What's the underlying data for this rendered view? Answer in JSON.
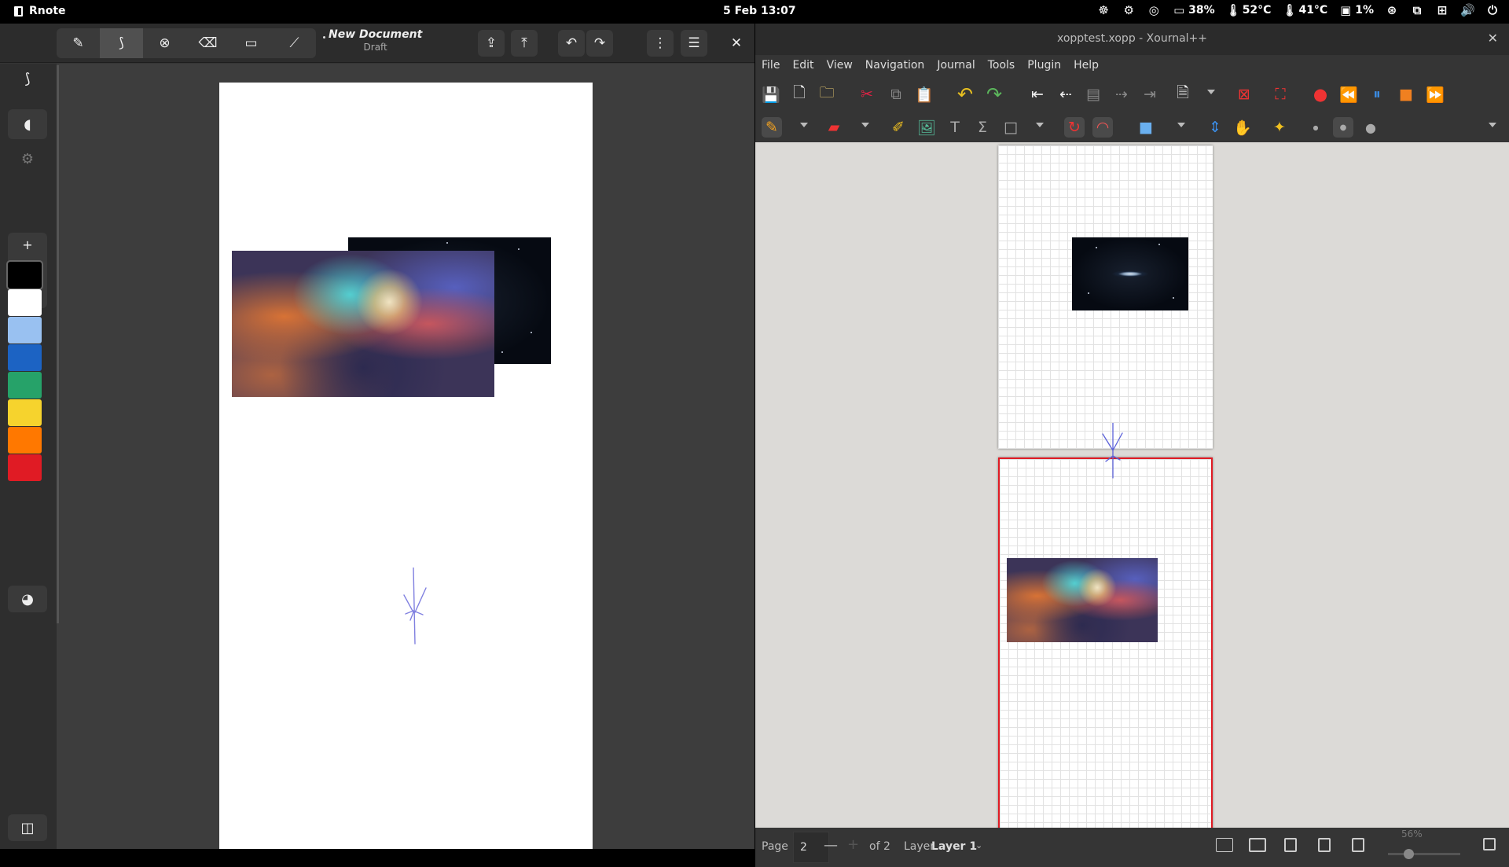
{
  "topbar": {
    "app_name": "Rnote",
    "clock": "5 Feb  13:07",
    "battery": "38%",
    "cpu_temp": "52°C",
    "gpu_temp": "41°C",
    "disk": "1%"
  },
  "rnote": {
    "tools": [
      "pen",
      "shaper",
      "selector",
      "eraser",
      "typewriter",
      "tools"
    ],
    "active_tool_index": 1,
    "doc_title": "New Document",
    "doc_status": "Draft",
    "pen_size": "3.8",
    "colors": [
      "#000000",
      "#ffffff",
      "#99c1f1",
      "#1c63c3",
      "#26a269",
      "#f6d32d",
      "#ff7800",
      "#e01b24"
    ],
    "stroke_color": "#8080e0"
  },
  "xournal": {
    "title": "xopptest.xopp - Xournal++",
    "menu": [
      "File",
      "Edit",
      "View",
      "Navigation",
      "Journal",
      "Tools",
      "Plugin",
      "Help"
    ],
    "status": {
      "page_label": "Page",
      "page_value": "2",
      "page_of": "of 2",
      "layer_label": "Layer",
      "layer_value": "Layer 1",
      "zoom": "56%"
    },
    "selected_page_border": "#e01b24",
    "stroke_color": "#5a60d8"
  }
}
